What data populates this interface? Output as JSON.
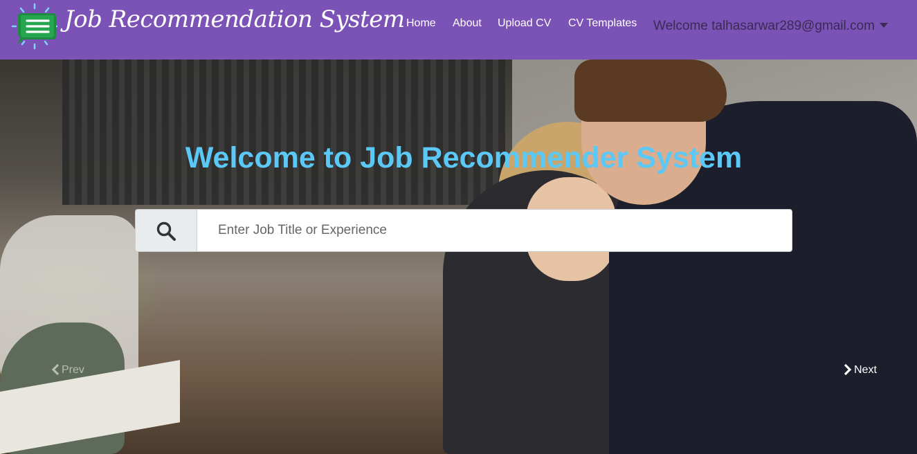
{
  "navbar": {
    "brand": "Job Recommendation System",
    "logo_icon": "menu-chat-bubble-icon",
    "links": [
      {
        "label": "Home"
      },
      {
        "label": "About"
      },
      {
        "label": "Upload CV"
      },
      {
        "label": "CV Templates"
      }
    ],
    "user_menu": {
      "label": "Welcome talhasarwar289@gmail.com",
      "icon": "caret-down-icon"
    },
    "bg_color": "#7b52b5"
  },
  "hero": {
    "title": "Welcome to Job Recommender System",
    "title_color": "#5bc8f5",
    "search": {
      "placeholder": "Enter Job Title or Experience",
      "value": "",
      "icon": "search-icon"
    },
    "prev_label": "Prev",
    "next_label": "Next"
  }
}
